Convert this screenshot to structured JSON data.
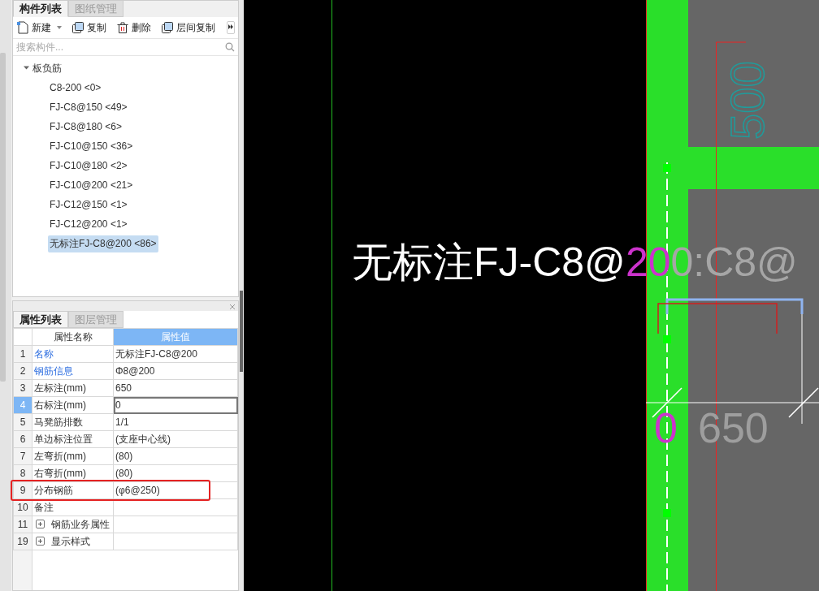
{
  "component_panel": {
    "tabs": [
      {
        "label": "构件列表",
        "selected": true
      },
      {
        "label": "图纸管理",
        "selected": false
      }
    ],
    "toolbar": [
      {
        "label": "新建",
        "kind": "new",
        "dropdown": true
      },
      {
        "label": "复制",
        "kind": "copy",
        "dropdown": false
      },
      {
        "label": "删除",
        "kind": "delete",
        "dropdown": false
      },
      {
        "label": "层间复制",
        "kind": "copy",
        "dropdown": false
      }
    ],
    "search": {
      "placeholder": "搜索构件..."
    },
    "tree": [
      {
        "label": "板负筋",
        "expanded": true,
        "selected": false,
        "children": [
          {
            "label": "C8-200",
            "count": "<0>",
            "selected": false
          },
          {
            "label": "FJ-C8@150",
            "count": "<49>",
            "selected": false
          },
          {
            "label": "FJ-C8@180",
            "count": "<6>",
            "selected": false
          },
          {
            "label": "FJ-C10@150",
            "count": "<36>",
            "selected": false
          },
          {
            "label": "FJ-C10@180",
            "count": "<2>",
            "selected": false
          },
          {
            "label": "FJ-C10@200",
            "count": "<21>",
            "selected": false
          },
          {
            "label": "FJ-C12@150",
            "count": "<1>",
            "selected": false
          },
          {
            "label": "FJ-C12@200",
            "count": "<1>",
            "selected": false
          },
          {
            "label": "无标注FJ-C8@200",
            "count": "<86>",
            "selected": true
          }
        ]
      }
    ]
  },
  "property_panel": {
    "tabs": [
      {
        "label": "属性列表",
        "selected": true
      },
      {
        "label": "图层管理",
        "selected": false
      }
    ],
    "columns": [
      "属性名称",
      "属性值"
    ],
    "rows": [
      {
        "index": "1",
        "kind": "field",
        "name": "名称",
        "value": "无标注FJ-C8@200",
        "link": true,
        "selected": false,
        "highlighted": false
      },
      {
        "index": "2",
        "kind": "field",
        "name": "钢筋信息",
        "value": "Φ8@200",
        "link": true,
        "selected": false,
        "highlighted": false
      },
      {
        "index": "3",
        "kind": "field",
        "name": "左标注(mm)",
        "value": "650",
        "link": false,
        "selected": false,
        "highlighted": false
      },
      {
        "index": "4",
        "kind": "field",
        "name": "右标注(mm)",
        "value": "0",
        "link": false,
        "selected": true,
        "highlighted": false
      },
      {
        "index": "5",
        "kind": "field",
        "name": "马凳筋排数",
        "value": "1/1",
        "link": false,
        "selected": false,
        "highlighted": false
      },
      {
        "index": "6",
        "kind": "field",
        "name": "单边标注位置",
        "value": "(支座中心线)",
        "link": false,
        "selected": false,
        "highlighted": false
      },
      {
        "index": "7",
        "kind": "field",
        "name": "左弯折(mm)",
        "value": "(80)",
        "link": false,
        "selected": false,
        "highlighted": false
      },
      {
        "index": "8",
        "kind": "field",
        "name": "右弯折(mm)",
        "value": "(80)",
        "link": false,
        "selected": false,
        "highlighted": false
      },
      {
        "index": "9",
        "kind": "field",
        "name": "分布钢筋",
        "value": "(φ6@250)",
        "link": false,
        "selected": false,
        "highlighted": true
      },
      {
        "index": "10",
        "kind": "field",
        "name": "备注",
        "link": false,
        "selected": false,
        "highlighted": false
      },
      {
        "index": "11",
        "kind": "group",
        "name": "钢筋业务属性",
        "link": false,
        "selected": false,
        "highlighted": false
      },
      {
        "index": "19",
        "kind": "group",
        "name": "显示样式",
        "link": false,
        "selected": false,
        "highlighted": false
      }
    ]
  },
  "canvas": {
    "label_segments": [
      {
        "text": "无标注FJ-C8@",
        "color": "#ffffff"
      },
      {
        "text": "20",
        "color": "#cc33cc"
      },
      {
        "text": "0:C8@",
        "color": "#a6a6a6"
      }
    ],
    "dimension_texts": [
      {
        "text": "0",
        "color": "#cc33cc"
      },
      {
        "text": "650",
        "color": "#9e9e9e"
      }
    ],
    "vertical_text": "500"
  }
}
